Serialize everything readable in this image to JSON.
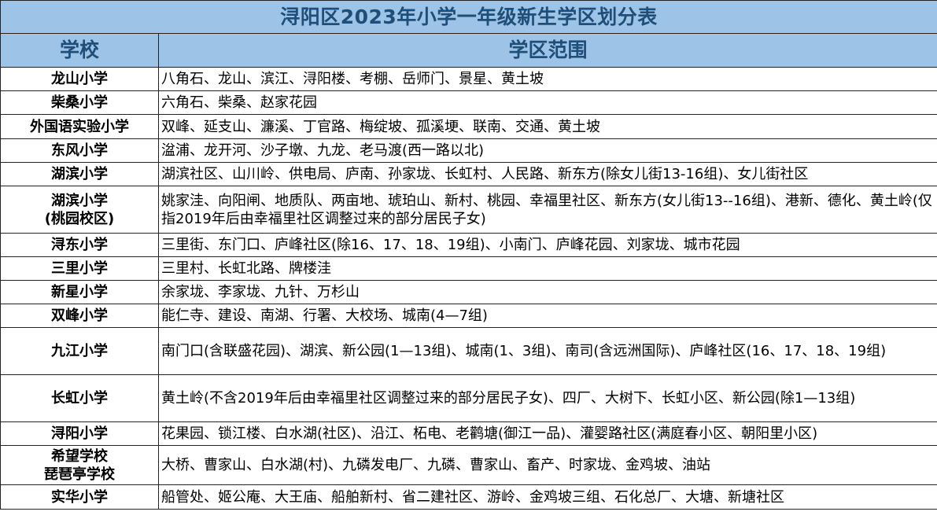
{
  "title": "浔阳区2023年小学一年级新生学区划分表",
  "headers": {
    "school": "学校",
    "range": "学区范围"
  },
  "rows": [
    {
      "school": [
        "龙山小学"
      ],
      "range": "八角石、龙山、滨江、浔阳楼、考棚、岳师门、景星、黄土坡"
    },
    {
      "school": [
        "柴桑小学"
      ],
      "range": "六角石、柴桑、赵家花园"
    },
    {
      "school": [
        "外国语实验小学"
      ],
      "range": "双峰、延支山、濂溪、丁官路、梅绽坡、孤溪埂、联南、交通、黄土坡"
    },
    {
      "school": [
        "东风小学"
      ],
      "range": "湓浦、龙开河、沙子墩、九龙、老马渡(西一路以北)"
    },
    {
      "school": [
        "湖滨小学"
      ],
      "range": "湖滨社区、山川岭、供电局、庐南、孙家垅、长虹村、人民路、新东方(除女儿街13-16组)、女儿街社区"
    },
    {
      "school": [
        "湖滨小学",
        "(桃园校区)"
      ],
      "range": "姚家洼、向阳闸、地质队、两亩地、琥珀山、新村、桃园、幸福里社区、新东方(女儿街13--16组)、港新、德化、黄土岭(仅指2019年后由幸福里社区调整过来的部分居民子女)"
    },
    {
      "school": [
        "浔东小学"
      ],
      "range": "三里街、东门口、庐峰社区(除16、17、18、19组)、小南门、庐峰花园、刘家垅、城市花园"
    },
    {
      "school": [
        "三里小学"
      ],
      "range": "三里村、长虹北路、牌楼洼"
    },
    {
      "school": [
        "新星小学"
      ],
      "range": "余家垅、李家垅、九针、万杉山"
    },
    {
      "school": [
        "双峰小学"
      ],
      "range": "能仁寺、建设、南湖、行署、大校场、城南(4—7组)"
    },
    {
      "school": [
        "九江小学"
      ],
      "range": "南门口(含联盛花园)、湖滨、新公园(1—13组)、城南(1、3组)、南司(含远洲国际)、庐峰社区(16、17、18、19组)"
    },
    {
      "school": [
        "长虹小学"
      ],
      "range": "黄土岭(不含2019年后由幸福里社区调整过来的部分居民子女)、四厂、大树下、长虹小区、新公园(除1—13组)"
    },
    {
      "school": [
        "浔阳小学"
      ],
      "range": "花果园、锁江楼、白水湖(社区)、沿江、柘电、老鹳塘(御江一品)、灌婴路社区(满庭春小区、朝阳里小区)"
    },
    {
      "school": [
        "希望学校",
        "琵琶亭学校"
      ],
      "range": "大桥、曹家山、白水湖(村)、九磷发电厂、九磷、曹家山、畜产、时家垅、金鸡坡、油站"
    },
    {
      "school": [
        "实华小学"
      ],
      "range": "船管处、姬公庵、大王庙、船舶新村、省二建社区、游岭、金鸡坡三组、石化总厂、大塘、新塘社区"
    }
  ]
}
